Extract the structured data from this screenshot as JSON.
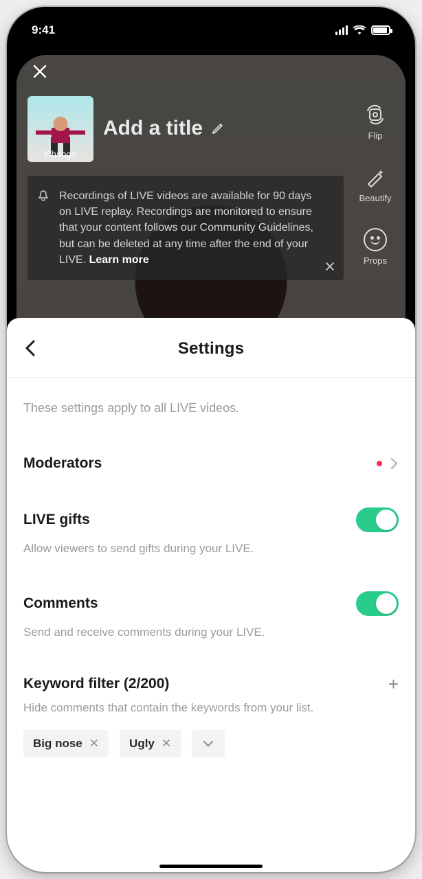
{
  "statusbar": {
    "time": "9:41"
  },
  "background": {
    "close_label": "Close",
    "thumb_label": "Change",
    "add_title_placeholder": "Add a title",
    "right_col": {
      "flip": "Flip",
      "beautify": "Beautify",
      "props": "Props"
    },
    "info": {
      "text": "Recordings of LIVE videos are available for 90 days on LIVE replay. Recordings are monitored to ensure that your content follows our Community Guidelines, but can be deleted at any time after the end of your LIVE.",
      "learn_more": "Learn more"
    }
  },
  "sheet": {
    "title": "Settings",
    "hint": "These settings apply to all LIVE videos.",
    "sections": {
      "moderators": {
        "title": "Moderators"
      },
      "gifts": {
        "title": "LIVE gifts",
        "sub": "Allow viewers to send gifts during your LIVE.",
        "on": true
      },
      "comments": {
        "title": "Comments",
        "sub": "Send and receive comments during your LIVE.",
        "on": true
      },
      "keyword_filter": {
        "title": "Keyword filter (2/200)",
        "sub": "Hide comments that contain the keywords from your list.",
        "chips": [
          "Big nose",
          "Ugly"
        ]
      }
    }
  }
}
